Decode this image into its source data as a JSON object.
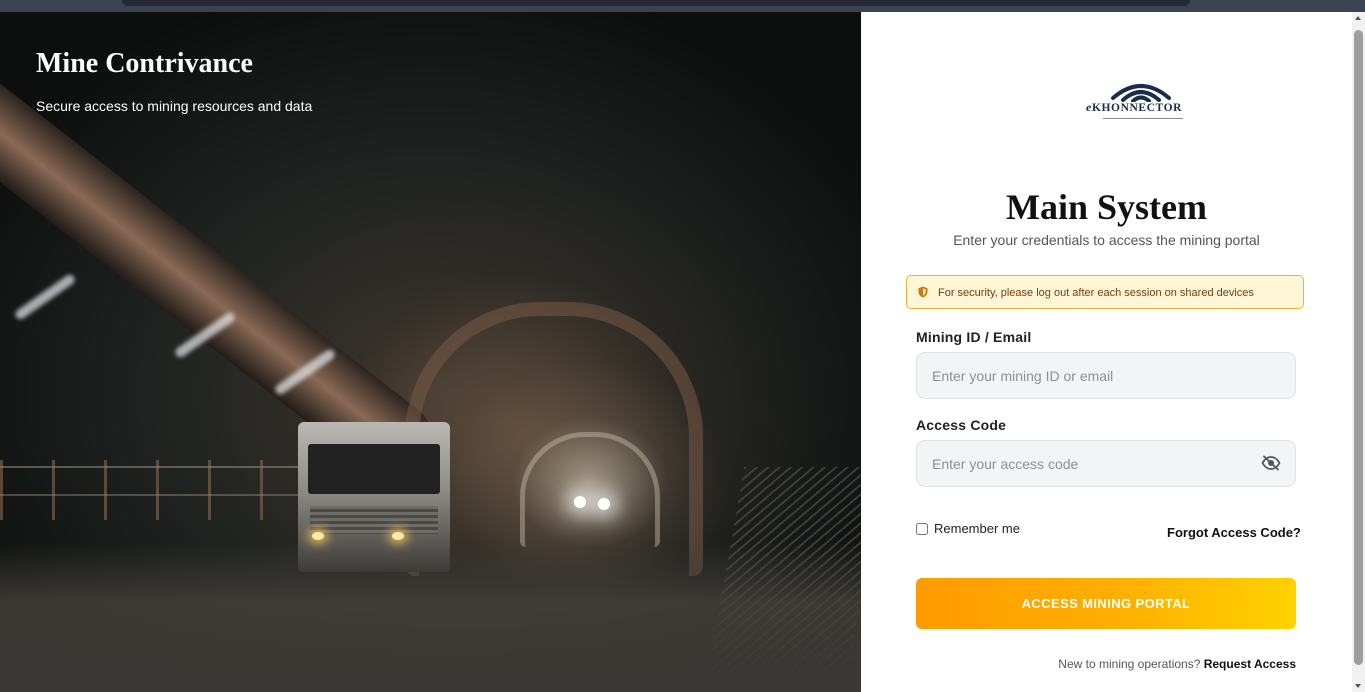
{
  "hero": {
    "title": "Mine Contrivance",
    "subtitle": "Secure access to mining resources and data"
  },
  "logo": {
    "prefix": "e",
    "name": "KHONNECTOR",
    "icon": "wifi-signal-icon",
    "color": "#1a2d4a"
  },
  "login": {
    "title": "Main System",
    "subtitle": "Enter your credentials to access the mining portal",
    "notice": "For security, please log out after each session on shared devices",
    "notice_icon": "shield-icon",
    "id_label": "Mining ID / Email",
    "id_placeholder": "Enter your mining ID or email",
    "code_label": "Access Code",
    "code_placeholder": "Enter your access code",
    "toggle_icon": "eye-slash-icon",
    "remember_label": "Remember me",
    "remember_checked": false,
    "forgot_link": "Forgot Access Code?",
    "submit_label": "ACCESS MINING PORTAL",
    "new_text": "New to mining operations?",
    "request_link": "Request Access"
  },
  "colors": {
    "accent_start": "#ff9a00",
    "accent_end": "#ffd200",
    "notice_bg": "#fef6d6",
    "notice_border": "#e6b53a",
    "notice_text": "#7a3c0a"
  }
}
